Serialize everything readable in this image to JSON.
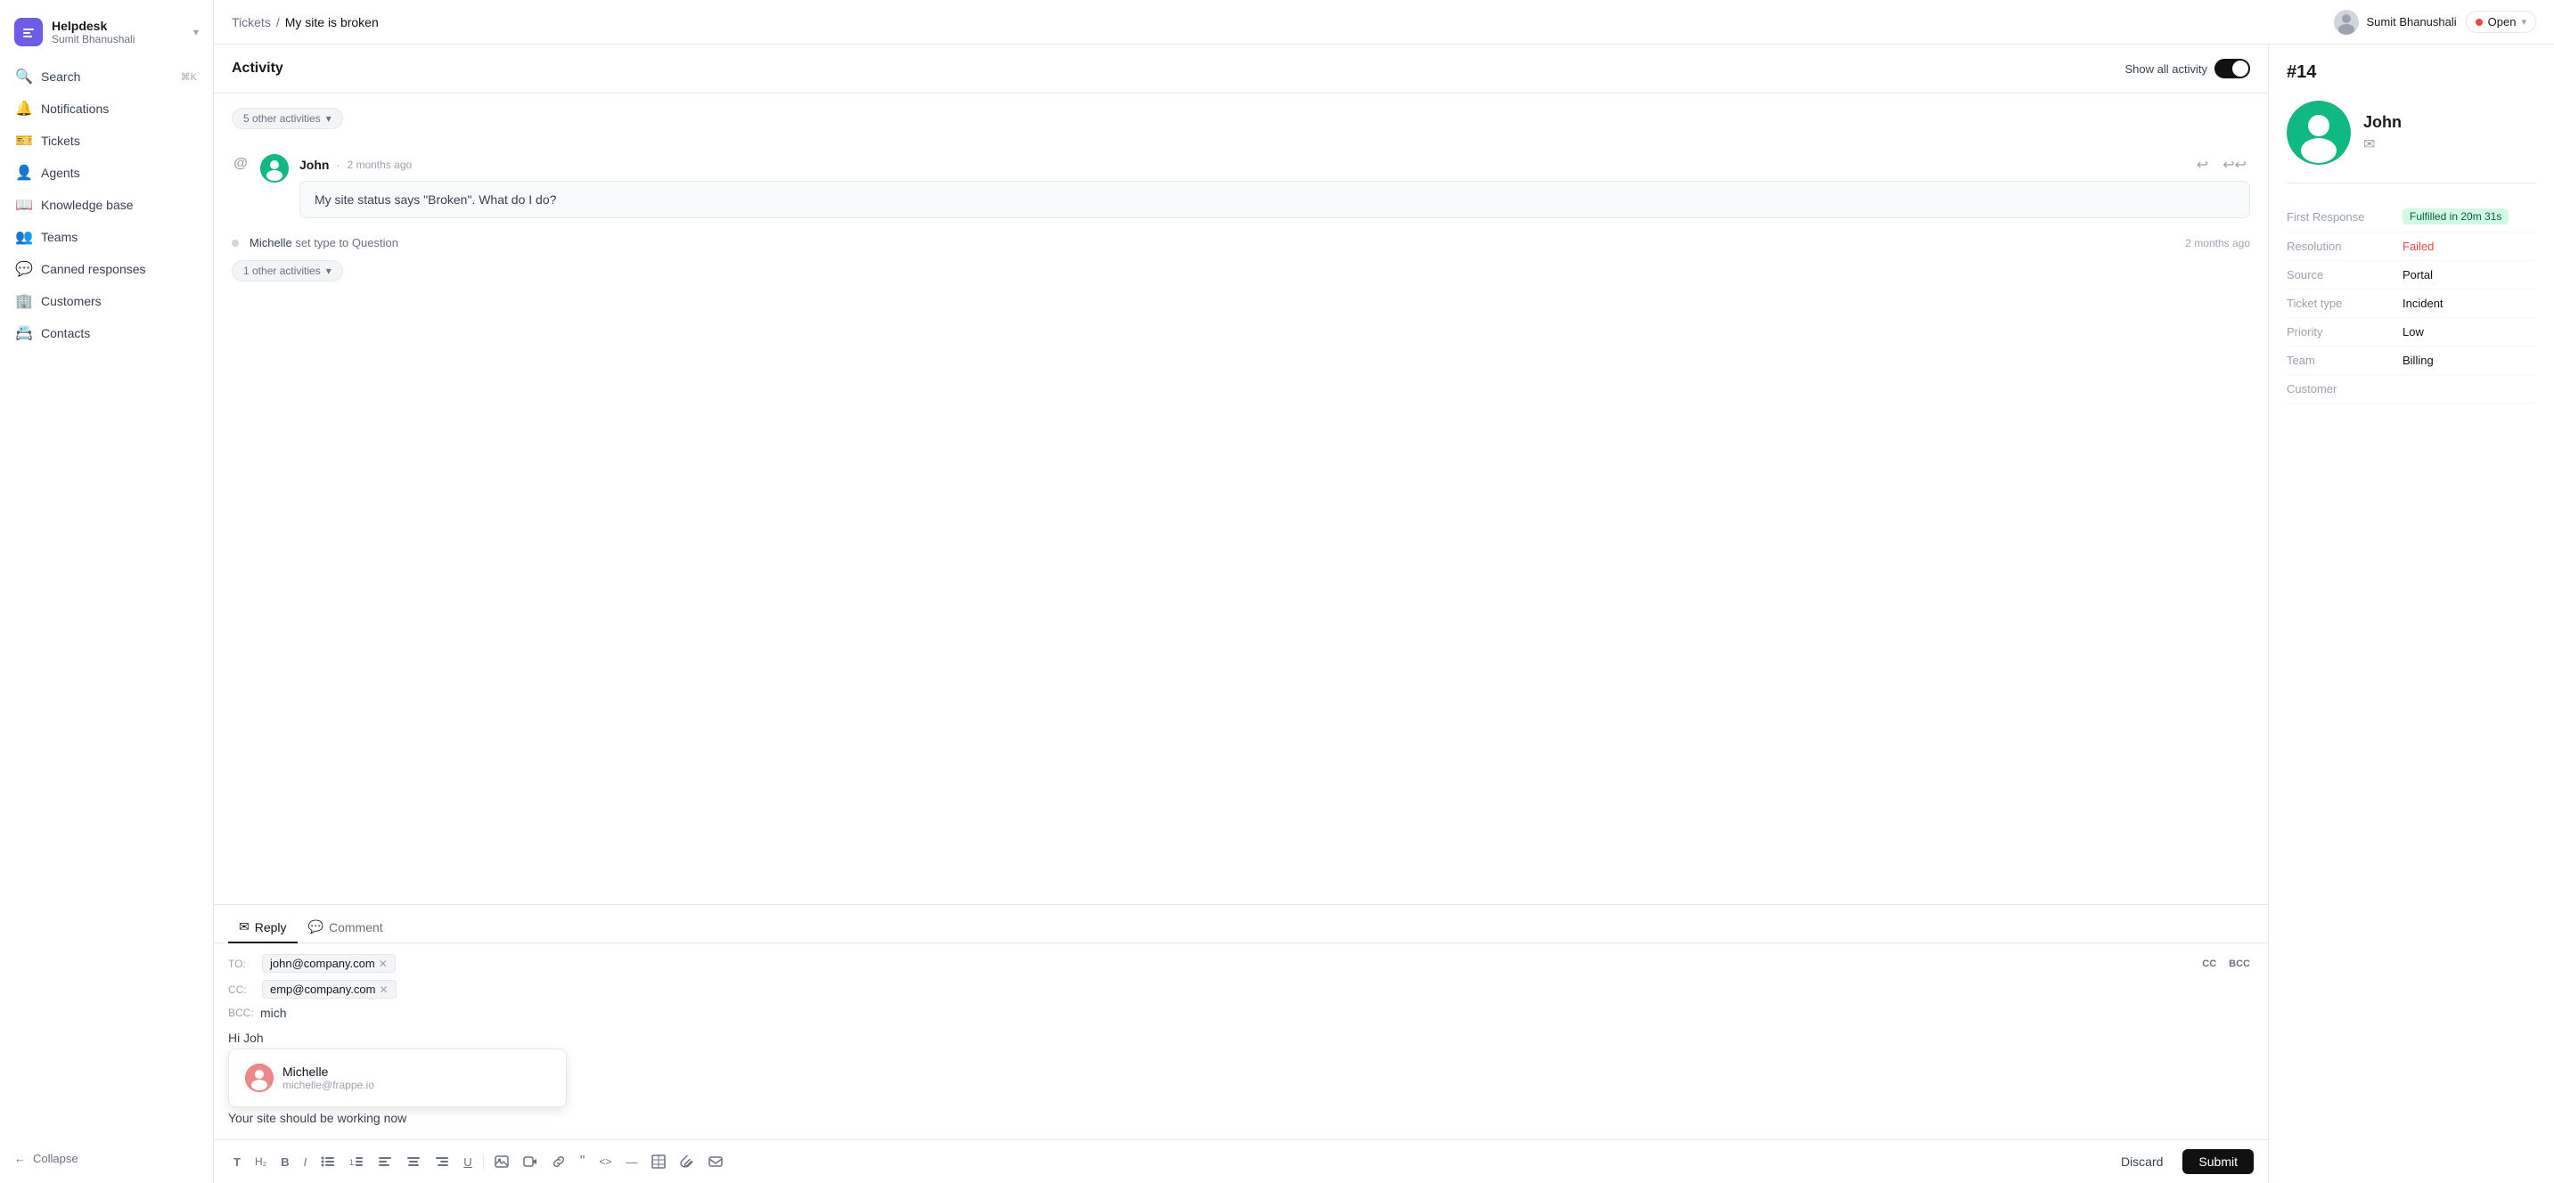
{
  "app": {
    "name": "Helpdesk",
    "user": "Sumit Bhanushali"
  },
  "sidebar": {
    "nav_items": [
      {
        "id": "search",
        "label": "Search",
        "shortcut": "⌘K",
        "icon": "🔍"
      },
      {
        "id": "notifications",
        "label": "Notifications",
        "icon": "🔔"
      },
      {
        "id": "tickets",
        "label": "Tickets",
        "icon": "🎫"
      },
      {
        "id": "agents",
        "label": "Agents",
        "icon": "👤"
      },
      {
        "id": "knowledge-base",
        "label": "Knowledge base",
        "icon": "📖"
      },
      {
        "id": "teams",
        "label": "Teams",
        "icon": "👥"
      },
      {
        "id": "canned-responses",
        "label": "Canned responses",
        "icon": "💬"
      },
      {
        "id": "customers",
        "label": "Customers",
        "icon": "🏢"
      },
      {
        "id": "contacts",
        "label": "Contacts",
        "icon": "📇"
      }
    ],
    "collapse_label": "Collapse"
  },
  "topbar": {
    "breadcrumb_root": "Tickets",
    "breadcrumb_sep": "/",
    "breadcrumb_current": "My site is broken",
    "user_name": "Sumit Bhanushali",
    "status_label": "Open",
    "ticket_number": "#14"
  },
  "activity": {
    "title": "Activity",
    "show_all_label": "Show all activity",
    "collapsed_group_1": "5 other activities",
    "message_1": {
      "author": "John",
      "time": "2 months ago",
      "content": "My site status says \"Broken\". What do I do?"
    },
    "activity_line": {
      "actor": "Michelle",
      "action": "set type to Question",
      "time": "2 months ago"
    },
    "collapsed_group_2": "1 other activities"
  },
  "reply": {
    "tab_reply": "Reply",
    "tab_comment": "Comment",
    "to_label": "TO:",
    "cc_label": "CC:",
    "bcc_label": "BCC:",
    "to_email": "john@company.com",
    "cc_email": "emp@company.com",
    "bcc_value": "mich",
    "body_text": "Hi Joh",
    "body_text2": "Your site should be working now",
    "cc_button": "CC",
    "bcc_button": "BCC",
    "discard_label": "Discard",
    "submit_label": "Submit"
  },
  "autocomplete": {
    "name": "Michelle",
    "email": "michelle@frappe.io"
  },
  "toolbar": {
    "buttons": [
      {
        "id": "text",
        "label": "T"
      },
      {
        "id": "heading",
        "label": "H₂"
      },
      {
        "id": "bold",
        "label": "B"
      },
      {
        "id": "italic",
        "label": "I"
      },
      {
        "id": "bullet-list",
        "label": "≡"
      },
      {
        "id": "ordered-list",
        "label": "≣"
      },
      {
        "id": "align-left",
        "label": "⬛"
      },
      {
        "id": "align-center",
        "label": "⬛"
      },
      {
        "id": "align-right",
        "label": "⬛"
      },
      {
        "id": "underline",
        "label": "U̲"
      },
      {
        "id": "image",
        "label": "🖼"
      },
      {
        "id": "video",
        "label": "📹"
      },
      {
        "id": "link",
        "label": "🔗"
      },
      {
        "id": "quote",
        "label": "❝"
      },
      {
        "id": "code",
        "label": "<>"
      },
      {
        "id": "divider",
        "label": "—"
      },
      {
        "id": "table",
        "label": "⊞"
      },
      {
        "id": "attachment",
        "label": "📎"
      },
      {
        "id": "email",
        "label": "✉"
      }
    ]
  },
  "contact": {
    "name": "John",
    "ticket_number": "#14"
  },
  "ticket_details": {
    "first_response_label": "First Response",
    "first_response_value": "Fulfilled in 20m 31s",
    "resolution_label": "Resolution",
    "resolution_value": "Failed",
    "source_label": "Source",
    "source_value": "Portal",
    "ticket_type_label": "Ticket type",
    "ticket_type_value": "Incident",
    "priority_label": "Priority",
    "priority_value": "Low",
    "team_label": "Team",
    "team_value": "Billing",
    "customer_label": "Customer",
    "customer_value": ""
  }
}
